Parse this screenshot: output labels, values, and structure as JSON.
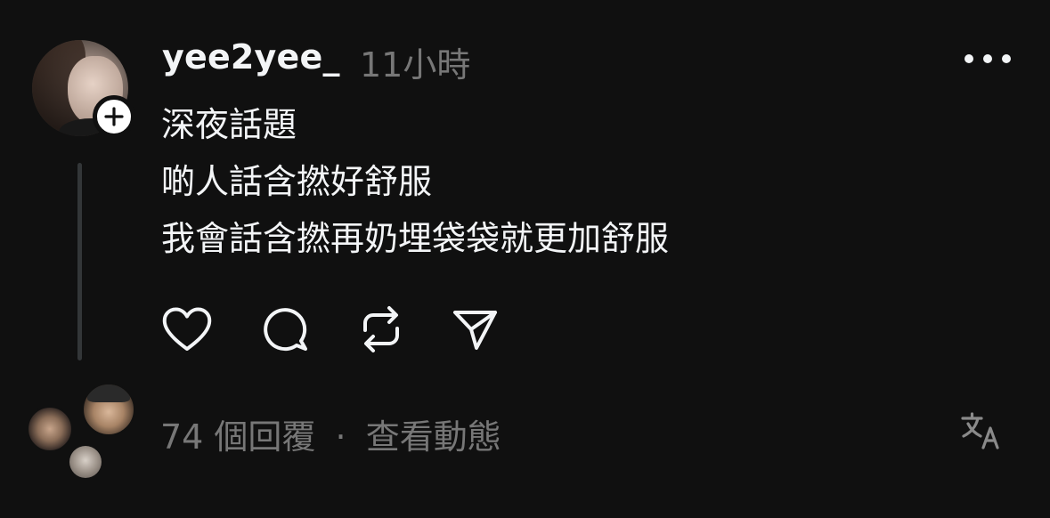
{
  "post": {
    "username": "yee2yee_",
    "timestamp": "11小時",
    "lines": [
      "深夜話題",
      "啲人話含撚好舒服",
      "我會話含撚再奶埋袋袋就更加舒服"
    ]
  },
  "actions": {
    "like_icon": "heart-icon",
    "comment_icon": "comment-icon",
    "repost_icon": "repost-icon",
    "share_icon": "send-icon"
  },
  "footer": {
    "replies_count": "74 個回覆",
    "separator": "·",
    "view_activity": "查看動態",
    "translate_icon": "translate-icon"
  },
  "colors": {
    "background": "#101010",
    "primary_text": "#f3f5f7",
    "secondary_text": "#777777",
    "thread_line": "#333638"
  }
}
